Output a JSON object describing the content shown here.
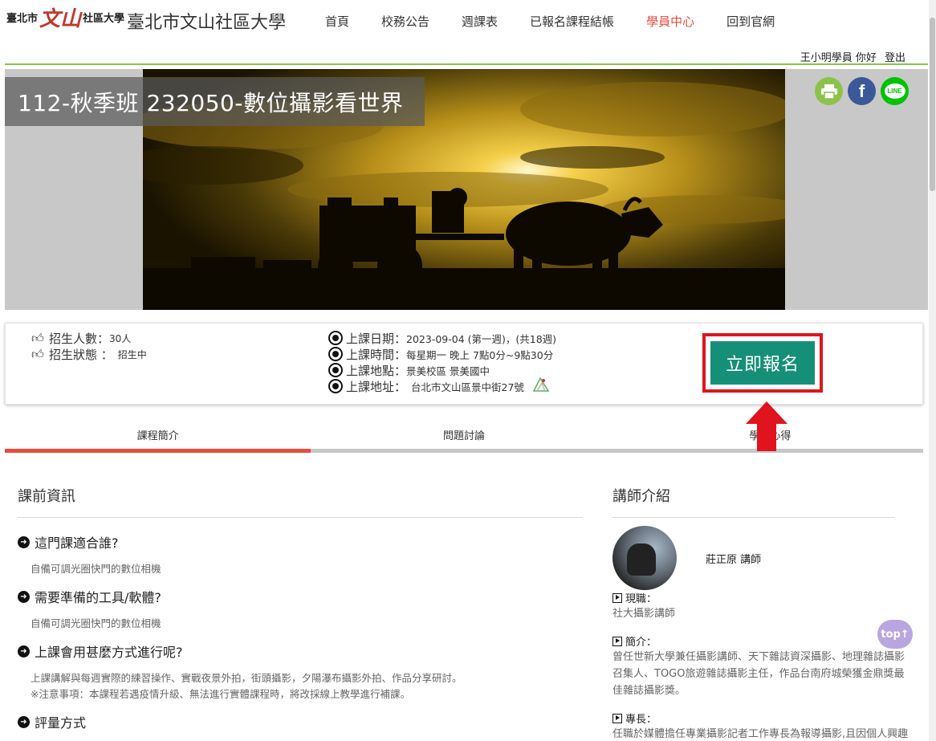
{
  "header": {
    "logo_prefix": "臺北市",
    "logo_wen": "文山",
    "logo_suffix": "社區大學",
    "site_title": "臺北市文山社區大學",
    "nav": [
      {
        "label": "首頁"
      },
      {
        "label": "校務公告"
      },
      {
        "label": "週課表"
      },
      {
        "label": "已報名課程結帳"
      },
      {
        "label": "學員中心"
      },
      {
        "label": "回到官網"
      }
    ],
    "active_nav": "學員中心",
    "user_greeting": "王小明學員 你好",
    "logout": "登出"
  },
  "hero": {
    "title": "112-秋季班 232050-數位攝影看世界",
    "share": {
      "print_icon": "print-icon",
      "facebook_icon": "f",
      "line_icon": "LINE"
    }
  },
  "info": {
    "enroll_count_label": "招生人數：",
    "enroll_count_value": "30人",
    "status_label": "招生狀態 ：",
    "status_value": "招生中",
    "date_label": "上課日期：",
    "date_value": "2023-09-04 (第一週)，(共18週)",
    "time_label": "上課時間：",
    "time_value": "每星期一 晚上 7點0分~9點30分",
    "place_label": "上課地點：",
    "place_value": "景美校區 景美國中",
    "address_label": "上課地址：",
    "address_value": "台北市文山區景中街27號",
    "signup_button": "立即報名"
  },
  "tabs": [
    {
      "label": "課程簡介"
    },
    {
      "label": "問題討論"
    },
    {
      "label": "學員心得"
    }
  ],
  "course": {
    "section_title": "課前資訊",
    "qa": [
      {
        "q": "這門課適合誰?",
        "a": "自備可調光圈快門的數位相機"
      },
      {
        "q": "需要準備的工具/軟體?",
        "a": "自備可調光圈快門的數位相機"
      },
      {
        "q": "上課會用甚麼方式進行呢?",
        "a": "上課講解與每週實際的練習操作、實戰夜景外拍，街頭攝影，夕陽瀑布攝影外拍、作品分享研討。",
        "a2": "※注意事項：本課程若遇疫情升級、無法進行實體課程時，將改採線上教學進行補課。"
      },
      {
        "q": "評量方式",
        "a": ""
      }
    ]
  },
  "teacher": {
    "section_title": "講師介紹",
    "name": "莊正原 講師",
    "current_label": "現職：",
    "current_text": "社大攝影講師",
    "intro_label": "簡介：",
    "intro_text": "曾任世新大學兼任攝影講師、天下雜誌資深攝影、地理雜誌攝影召集人、TOGO旅遊雜誌攝影主任，作品台南府城榮獲金鼎獎最佳雜誌攝影獎。",
    "expertise_label": "專長：",
    "expertise_text": "任職於媒體擔任專業攝影記者工作專長為報導攝影,且因個人興趣領有登山響導證將登山與風景攝影結合"
  },
  "top_button": "top↑",
  "colors": {
    "accent_red": "#e74c3c",
    "nav_green_rule": "#8bc34a",
    "signup_teal": "#168f78",
    "highlight_red": "#e0141e"
  }
}
